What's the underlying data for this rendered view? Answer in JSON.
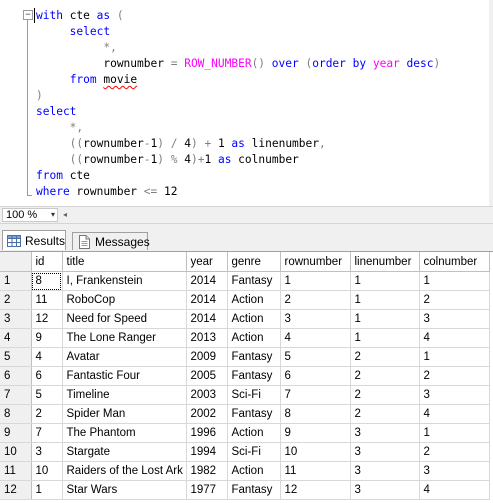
{
  "editor": {
    "fold_symbol": "−",
    "lines": [
      [
        {
          "t": "with ",
          "c": "kw"
        },
        {
          "t": "cte ",
          "c": ""
        },
        {
          "t": "as ",
          "c": "kw"
        },
        {
          "t": "(",
          "c": "op"
        }
      ],
      [
        {
          "t": "     select",
          "c": "kw"
        }
      ],
      [
        {
          "t": "          *",
          "c": "op"
        },
        {
          "t": ",",
          "c": "op"
        }
      ],
      [
        {
          "t": "          rownumber ",
          "c": ""
        },
        {
          "t": "= ",
          "c": "op"
        },
        {
          "t": "ROW_NUMBER",
          "c": "fn"
        },
        {
          "t": "() ",
          "c": "op"
        },
        {
          "t": "over ",
          "c": "kw"
        },
        {
          "t": "(",
          "c": "op"
        },
        {
          "t": "order by ",
          "c": "kw"
        },
        {
          "t": "year ",
          "c": "fn"
        },
        {
          "t": "desc",
          "c": "kw"
        },
        {
          "t": ")",
          "c": "op"
        }
      ],
      [
        {
          "t": "     ",
          "c": ""
        },
        {
          "t": "from ",
          "c": "kw"
        },
        {
          "t": "movie",
          "c": "squiggle"
        }
      ],
      [
        {
          "t": ")",
          "c": "op"
        }
      ],
      [
        {
          "t": "select",
          "c": "kw"
        }
      ],
      [
        {
          "t": "     *",
          "c": "op"
        },
        {
          "t": ",",
          "c": "op"
        }
      ],
      [
        {
          "t": "     ((",
          "c": "op"
        },
        {
          "t": "rownumber",
          "c": ""
        },
        {
          "t": "-",
          "c": "op"
        },
        {
          "t": "1",
          "c": ""
        },
        {
          "t": ") / ",
          "c": "op"
        },
        {
          "t": "4",
          "c": ""
        },
        {
          "t": ") + ",
          "c": "op"
        },
        {
          "t": "1 ",
          "c": ""
        },
        {
          "t": "as ",
          "c": "kw"
        },
        {
          "t": "linenumber",
          "c": ""
        },
        {
          "t": ",",
          "c": "op"
        }
      ],
      [
        {
          "t": "     ((",
          "c": "op"
        },
        {
          "t": "rownumber",
          "c": ""
        },
        {
          "t": "-",
          "c": "op"
        },
        {
          "t": "1",
          "c": ""
        },
        {
          "t": ") % ",
          "c": "op"
        },
        {
          "t": "4",
          "c": ""
        },
        {
          "t": ")+",
          "c": "op"
        },
        {
          "t": "1 ",
          "c": ""
        },
        {
          "t": "as ",
          "c": "kw"
        },
        {
          "t": "colnumber",
          "c": ""
        }
      ],
      [
        {
          "t": "from ",
          "c": "kw"
        },
        {
          "t": "cte",
          "c": ""
        }
      ],
      [
        {
          "t": "where ",
          "c": "kw"
        },
        {
          "t": "rownumber ",
          "c": ""
        },
        {
          "t": "<= ",
          "c": "op"
        },
        {
          "t": "12",
          "c": ""
        }
      ]
    ]
  },
  "zoom": {
    "value": "100 %",
    "dropdown_glyph": "▾",
    "scroll_left_glyph": "◂"
  },
  "tabs": {
    "results_label": "Results",
    "messages_label": "Messages"
  },
  "grid": {
    "columns": [
      "id",
      "title",
      "year",
      "genre",
      "rownumber",
      "linenumber",
      "colnumber"
    ],
    "rows": [
      [
        "1",
        "8",
        "I, Frankenstein",
        "2014",
        "Fantasy",
        "1",
        "1",
        "1"
      ],
      [
        "2",
        "11",
        "RoboCop",
        "2014",
        "Action",
        "2",
        "1",
        "2"
      ],
      [
        "3",
        "12",
        "Need for Speed",
        "2014",
        "Action",
        "3",
        "1",
        "3"
      ],
      [
        "4",
        "9",
        "The Lone Ranger",
        "2013",
        "Action",
        "4",
        "1",
        "4"
      ],
      [
        "5",
        "4",
        "Avatar",
        "2009",
        "Fantasy",
        "5",
        "2",
        "1"
      ],
      [
        "6",
        "6",
        "Fantastic Four",
        "2005",
        "Fantasy",
        "6",
        "2",
        "2"
      ],
      [
        "7",
        "5",
        "Timeline",
        "2003",
        "Sci-Fi",
        "7",
        "2",
        "3"
      ],
      [
        "8",
        "2",
        "Spider Man",
        "2002",
        "Fantasy",
        "8",
        "2",
        "4"
      ],
      [
        "9",
        "7",
        "The Phantom",
        "1996",
        "Action",
        "9",
        "3",
        "1"
      ],
      [
        "10",
        "3",
        "Stargate",
        "1994",
        "Sci-Fi",
        "10",
        "3",
        "2"
      ],
      [
        "11",
        "10",
        "Raiders of the Lost Ark",
        "1982",
        "Action",
        "11",
        "3",
        "3"
      ],
      [
        "12",
        "1",
        "Star Wars",
        "1977",
        "Fantasy",
        "12",
        "3",
        "4"
      ]
    ]
  },
  "colors": {
    "keyword": "#0000ff",
    "function": "#ff00ff",
    "operator": "#808080",
    "squiggle": "#ff0000"
  }
}
